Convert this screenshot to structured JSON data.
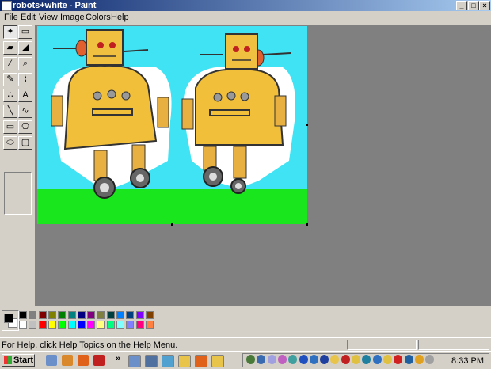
{
  "window": {
    "title": "robots+white - Paint",
    "controls": {
      "minimize": "_",
      "maximize": "□",
      "close": "×"
    }
  },
  "menu": [
    "File",
    "Edit",
    "View",
    "Image",
    "Colors",
    "Help"
  ],
  "tools": [
    {
      "name": "free-form-select-tool",
      "glyph": "✦"
    },
    {
      "name": "select-tool",
      "glyph": "▭"
    },
    {
      "name": "eraser-tool",
      "glyph": "▰"
    },
    {
      "name": "fill-tool",
      "glyph": "◢"
    },
    {
      "name": "pick-color-tool",
      "glyph": "∕"
    },
    {
      "name": "magnifier-tool",
      "glyph": "⌕"
    },
    {
      "name": "pencil-tool",
      "glyph": "✎"
    },
    {
      "name": "brush-tool",
      "glyph": "⌇"
    },
    {
      "name": "airbrush-tool",
      "glyph": "∴"
    },
    {
      "name": "text-tool",
      "glyph": "A"
    },
    {
      "name": "line-tool",
      "glyph": "╲"
    },
    {
      "name": "curve-tool",
      "glyph": "∿"
    },
    {
      "name": "rectangle-tool",
      "glyph": "▭"
    },
    {
      "name": "polygon-tool",
      "glyph": "⎔"
    },
    {
      "name": "ellipse-tool",
      "glyph": "⬭"
    },
    {
      "name": "rounded-rectangle-tool",
      "glyph": "▢"
    }
  ],
  "colors": {
    "foreground": "#000000",
    "background": "#ffffff",
    "palette_top": [
      "#000000",
      "#808080",
      "#800000",
      "#808000",
      "#008000",
      "#008080",
      "#000080",
      "#800080",
      "#808040",
      "#004040",
      "#0080ff",
      "#004080",
      "#8000ff",
      "#804000"
    ],
    "palette_bottom": [
      "#ffffff",
      "#c0c0c0",
      "#ff0000",
      "#ffff00",
      "#00ff00",
      "#00ffff",
      "#0000ff",
      "#ff00ff",
      "#ffff80",
      "#00ff80",
      "#80ffff",
      "#8080ff",
      "#ff0080",
      "#ff8040"
    ]
  },
  "status": {
    "help_text": "For Help, click Help Topics on the Help Menu."
  },
  "taskbar": {
    "start_label": "Start",
    "clock": "8:33 PM",
    "chevron": "»",
    "quick_launch": [
      {
        "name": "show-desktop-icon",
        "color": "#6b8fc9"
      },
      {
        "name": "paint-icon",
        "color": "#d9882b"
      },
      {
        "name": "firefox-icon",
        "color": "#e0611a"
      },
      {
        "name": "bug-icon",
        "color": "#c02020"
      }
    ],
    "tasks": [
      {
        "name": "task-window-1",
        "color": "#6b8fc9"
      },
      {
        "name": "task-window-2",
        "color": "#5070a0"
      },
      {
        "name": "task-window-3",
        "color": "#50a0d0"
      },
      {
        "name": "task-folder-1",
        "color": "#e8c44a"
      },
      {
        "name": "task-firefox",
        "color": "#e0611a"
      },
      {
        "name": "task-folder-2",
        "color": "#e8c44a"
      }
    ],
    "tray_icons": [
      {
        "name": "tray-icon-1",
        "color": "#4a7a3a"
      },
      {
        "name": "tray-icon-2",
        "color": "#3a6ab0"
      },
      {
        "name": "tray-icon-3",
        "color": "#a0a0e0"
      },
      {
        "name": "tray-icon-4",
        "color": "#c060c0"
      },
      {
        "name": "tray-icon-5",
        "color": "#40a0a0"
      },
      {
        "name": "tray-icon-6",
        "color": "#2050c0"
      },
      {
        "name": "tray-icon-7",
        "color": "#3070c0"
      },
      {
        "name": "tray-icon-8",
        "color": "#2040a0"
      },
      {
        "name": "tray-icon-9",
        "color": "#e8c44a"
      },
      {
        "name": "tray-icon-10",
        "color": "#c02020"
      },
      {
        "name": "tray-icon-11",
        "color": "#e0c040"
      },
      {
        "name": "tray-icon-12",
        "color": "#2080a0"
      },
      {
        "name": "tray-icon-13",
        "color": "#3070c0"
      },
      {
        "name": "tray-icon-14",
        "color": "#e0c040"
      },
      {
        "name": "tray-icon-15",
        "color": "#d02020"
      },
      {
        "name": "tray-icon-16",
        "color": "#2060a0"
      },
      {
        "name": "tray-icon-17",
        "color": "#e0a020"
      },
      {
        "name": "tray-icon-18",
        "color": "#a0a0a0"
      }
    ]
  }
}
